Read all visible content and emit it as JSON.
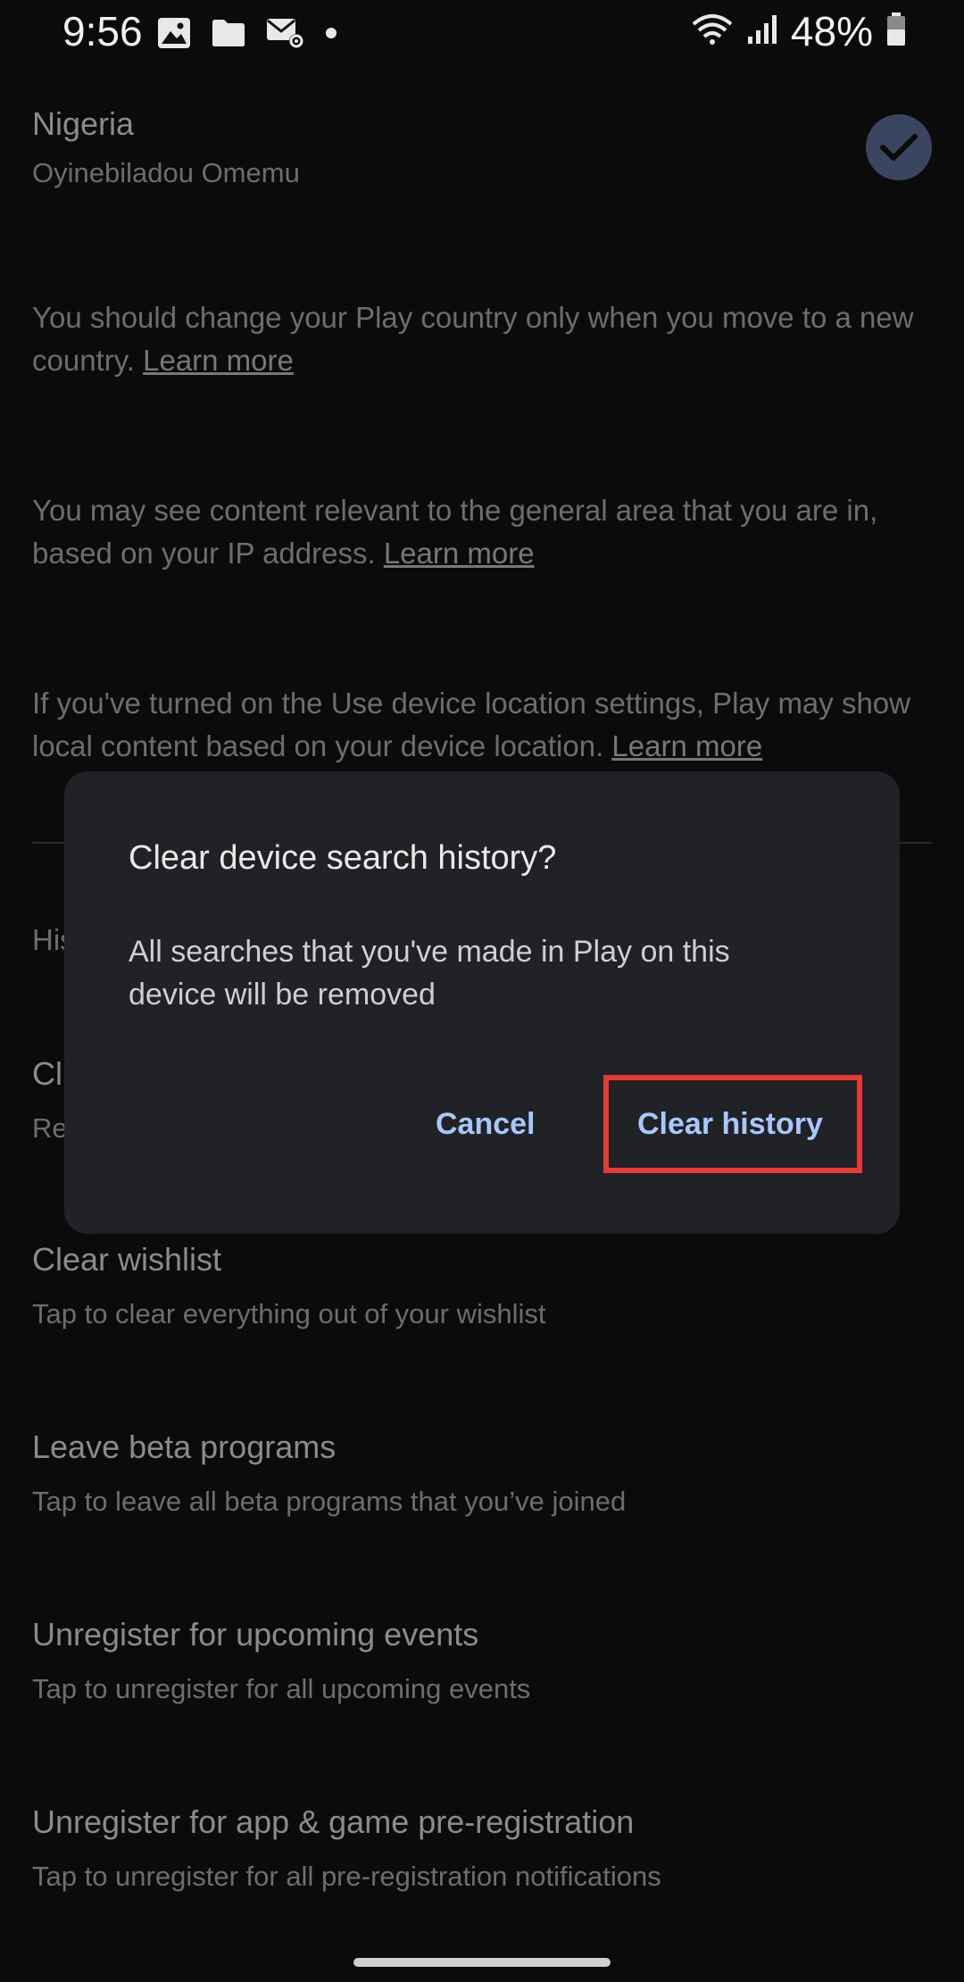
{
  "status_bar": {
    "time": "9:56",
    "left_icons": [
      "gallery-icon",
      "folder-icon",
      "mail-settings-icon",
      "dot-icon"
    ],
    "right_icons": [
      "wifi-icon",
      "signal-icon",
      "battery-icon"
    ],
    "battery": "48%"
  },
  "country": {
    "name": "Nigeria",
    "account": "Oyinebiladou Omemu"
  },
  "info": {
    "p1_text": "You should change your Play country only when you move to a new country.",
    "p1_link": "Learn more",
    "p2_text": "You may see content relevant to the general area that you are in, based on your IP address.",
    "p2_link": "Learn more",
    "p3_text": "If you've turned on the Use device location settings, Play may show local content based on your device location.",
    "p3_link": "Learn more"
  },
  "history_partial": {
    "section_label": "His",
    "item_title": "Cl",
    "item_sub": "Re"
  },
  "settings_items": [
    {
      "title": "Clear wishlist",
      "subtitle": "Tap to clear everything out of your wishlist"
    },
    {
      "title": "Leave beta programs",
      "subtitle": "Tap to leave all beta programs that you’ve joined"
    },
    {
      "title": "Unregister for upcoming events",
      "subtitle": "Tap to unregister for all upcoming events"
    },
    {
      "title": "Unregister for app & game pre-registration",
      "subtitle": "Tap to unregister for all pre-registration notifications"
    }
  ],
  "dialog": {
    "title": "Clear device search history?",
    "body": "All searches that you've made in Play on this device will be removed",
    "cancel": "Cancel",
    "confirm": "Clear history"
  },
  "colors": {
    "accent": "#a8c7fa",
    "highlight": "#e53935"
  }
}
